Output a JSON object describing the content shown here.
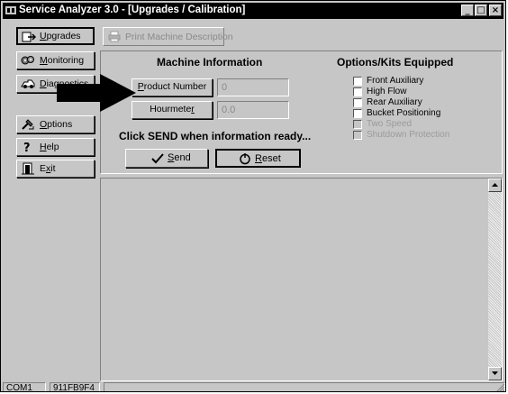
{
  "window": {
    "title": "Service Analyzer 3.0 - [Upgrades / Calibration]",
    "minimize_glyph": "_",
    "maximize_glyph": "□",
    "close_glyph": "×"
  },
  "nav": {
    "upgrades": {
      "pre": "",
      "key": "U",
      "post": "pgrades",
      "icon": "upgrade-icon"
    },
    "monitoring": {
      "pre": "",
      "key": "M",
      "post": "onitoring",
      "icon": "monitor-icon"
    },
    "diagnostics": {
      "pre": "",
      "key": "D",
      "post": "iagnostics",
      "icon": "diagnostics-icon"
    },
    "options": {
      "pre": "",
      "key": "O",
      "post": "ptions",
      "icon": "options-icon"
    },
    "help": {
      "pre": "",
      "key": "H",
      "post": "elp",
      "icon": "help-icon"
    },
    "exit": {
      "pre": "E",
      "key": "x",
      "post": "it",
      "icon": "exit-icon"
    }
  },
  "toolbar": {
    "print_label": "Print Machine Description"
  },
  "machine_info": {
    "heading": "Machine Information",
    "product_number": {
      "pre": "",
      "key": "P",
      "post": "roduct Number",
      "value": "0"
    },
    "hourmeter": {
      "pre": "Hourmete",
      "key": "r",
      "post": "",
      "value": "0.0"
    }
  },
  "options_kits": {
    "heading": "Options/Kits Equipped",
    "items": [
      {
        "label": "Front Auxiliary",
        "checked": false,
        "enabled": true
      },
      {
        "label": "High Flow",
        "checked": false,
        "enabled": true
      },
      {
        "label": "Rear Auxiliary",
        "checked": false,
        "enabled": true
      },
      {
        "label": "Bucket Positioning",
        "checked": false,
        "enabled": true
      },
      {
        "label": "Two Speed",
        "checked": false,
        "enabled": false
      },
      {
        "label": "Shutdown Protection",
        "checked": false,
        "enabled": false
      }
    ]
  },
  "prompt": "Click SEND when information ready...",
  "actions": {
    "send": {
      "pre": "",
      "key": "S",
      "post": "end"
    },
    "reset": {
      "pre": "",
      "key": "R",
      "post": "eset"
    }
  },
  "statusbar": {
    "port": "COM1",
    "code": "911FB9F4"
  },
  "colors": {
    "face": "#c6c6c6",
    "titlebar": "#000000",
    "disabled_text": "#8a8a8a"
  }
}
